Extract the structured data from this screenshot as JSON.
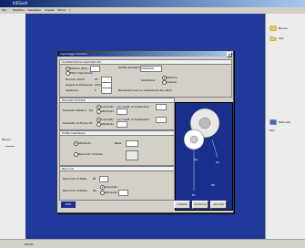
{
  "window": {
    "title": "KISSsoft"
  },
  "menu": [
    "File",
    "Modifica",
    "Visualizza",
    "Impost.",
    "Strum.",
    "?"
  ],
  "right_panel": {
    "items": [
      {
        "label": "Nuovo",
        "icon": "new-document-icon"
      },
      {
        "label": "Apri",
        "icon": "open-folder-icon"
      },
      {
        "label": "Manuale",
        "icon": "book-icon"
      },
      {
        "label": "Esci",
        "icon": "exit-icon"
      }
    ]
  },
  "left_panel": {
    "label": "Nuovo"
  },
  "statusbar": {
    "text": "Pronto"
  },
  "dialog": {
    "title": "Ingranaggi Cilindrici",
    "section_geometry": "Caratteristiche Geometriche",
    "modulo_label": "Modulo (Mn)",
    "passo_label": "Pitch Diametrale",
    "numero_denti_label": "Numero Denti",
    "angolo_label": "Angolo di Pressione",
    "spessore_label": "Spessore",
    "profile_label": "Profilo dentatura",
    "profile_value": "STANDARD",
    "z1": "Z1",
    "alpha": "Alpha",
    "b": "b",
    "dentatura_label": "Dentatura",
    "esterna": "Esterna",
    "interna": "Interna",
    "note": "Necessario per la valutazione dei valori",
    "section_teeth": "Diametri Primitivi",
    "diam_esterno_label": "Diametro Esterno",
    "diam_fondo_label": "Diametro di Fondo",
    "da": "Da",
    "df": "Df",
    "calcolato": "Calcolato",
    "attribuito": "Attribuito",
    "coeff_add": "con Coeff. di Addendum",
    "coeff_ded": "con Coeff. di Dedendum",
    "section_profile": "Profilo Dentatura",
    "raccordo_label": "Raccordo",
    "base_label": "Base",
    "radius_label": "Raccordo di fondo",
    "section_raccordi": "Raccordi",
    "raccordo_testa": "Raccordo di Testa",
    "raccordo_piede": "Raccordo di Piede",
    "rt": "Rt",
    "rp": "Rp",
    "logo": "KISS",
    "btn_indietro": "Indietro",
    "btn_continua": "Continua",
    "btn_annulla": "Annulla",
    "gear_labels": [
      "Da",
      "Dp",
      "Db",
      "Df"
    ]
  }
}
